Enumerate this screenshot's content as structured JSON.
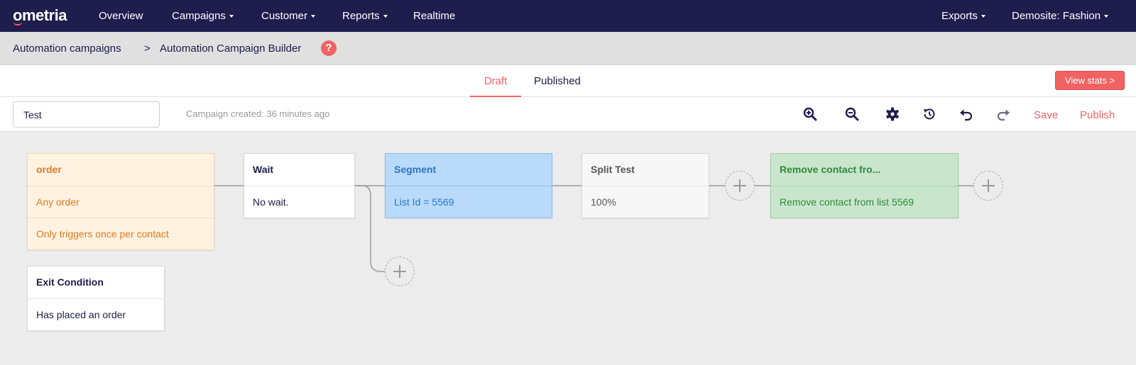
{
  "app": {
    "logo": "ometria",
    "nav": {
      "overview": "Overview",
      "campaigns": "Campaigns",
      "customer": "Customer",
      "reports": "Reports",
      "realtime": "Realtime",
      "exports": "Exports",
      "site": "Demosite: Fashion"
    }
  },
  "breadcrumb": {
    "parent": "Automation campaigns",
    "separator": ">",
    "current": "Automation Campaign Builder",
    "help": "?"
  },
  "tabs": {
    "draft": "Draft",
    "published": "Published",
    "active": "Draft",
    "view_stats": "View stats >"
  },
  "toolbar": {
    "campaign_name": "Test",
    "created": "Campaign created: 36 minutes ago",
    "icons": [
      "zoom-in-icon",
      "zoom-out-icon",
      "settings-gear-icon",
      "history-icon",
      "undo-icon",
      "redo-icon"
    ],
    "save": "Save",
    "publish": "Publish"
  },
  "canvas": {
    "trigger": {
      "title": "order",
      "line1": "Any order",
      "line2": "Only triggers once per contact"
    },
    "wait": {
      "title": "Wait",
      "detail": "No wait."
    },
    "segment": {
      "title": "Segment",
      "detail": "List Id = 5569"
    },
    "split": {
      "title": "Split Test",
      "detail": "100%"
    },
    "remove": {
      "title": "Remove contact fro...",
      "detail": "Remove contact from list 5569"
    },
    "exit": {
      "title": "Exit Condition",
      "detail": "Has placed an order"
    }
  },
  "colors": {
    "nav_bg": "#1f1d4e",
    "accent": "#f16363",
    "trigger_bg": "#fff2e1",
    "segment_bg": "#b9dafa",
    "action_bg": "#c9e6cd"
  }
}
